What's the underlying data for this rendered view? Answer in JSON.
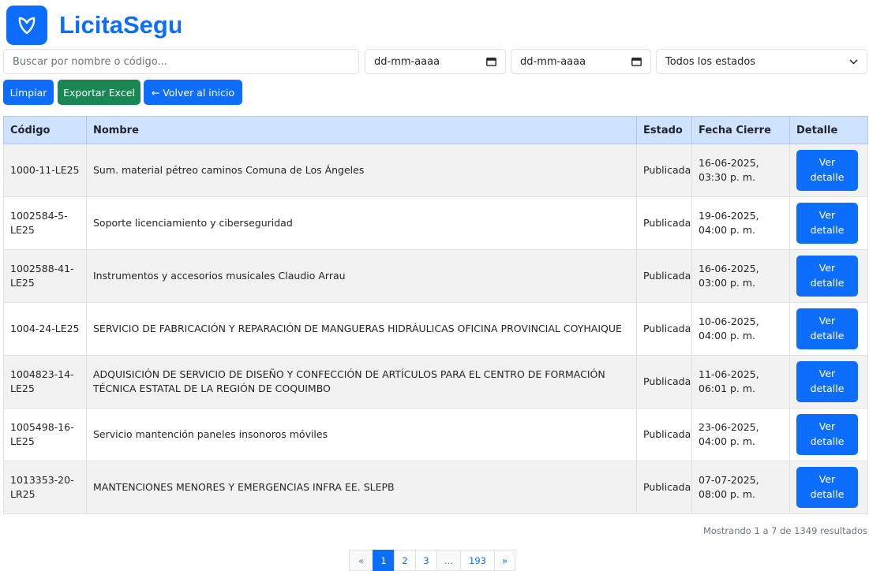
{
  "brand": {
    "name": "LicitaSegu",
    "logo_icon": "heart-outline-icon",
    "color": "#0d6efd"
  },
  "filters": {
    "search_placeholder": "Buscar por nombre o código...",
    "date_from": "dd-mm-aaaa",
    "date_to": "dd-mm-aaaa",
    "status_selected": "Todos los estados"
  },
  "actions": {
    "clear_label": "Limpiar",
    "export_label": "Exportar Excel",
    "back_label": "← Volver al inicio"
  },
  "table": {
    "headers": {
      "code": "Código",
      "name": "Nombre",
      "status": "Estado",
      "close_date": "Fecha Cierre",
      "detail": "Detalle"
    },
    "detail_button": "Ver detalle",
    "rows": [
      {
        "code": "1000-11-LE25",
        "name": "Sum. material pétreo caminos Comuna de Los Ángeles",
        "status": "Publicada",
        "close_date": "16-06-2025, 03:30 p. m."
      },
      {
        "code": "1002584-5-LE25",
        "name": "Soporte licenciamiento y ciberseguridad",
        "status": "Publicada",
        "close_date": "19-06-2025, 04:00 p. m."
      },
      {
        "code": "1002588-41-LE25",
        "name": "Instrumentos y accesorios musicales Claudio Arrau",
        "status": "Publicada",
        "close_date": "16-06-2025, 03:00 p. m."
      },
      {
        "code": "1004-24-LE25",
        "name": "SERVICIO DE FABRICACIÓN Y REPARACIÓN DE MANGUERAS HIDRÁULICAS OFICINA PROVINCIAL COYHAIQUE",
        "status": "Publicada",
        "close_date": "10-06-2025, 04:00 p. m."
      },
      {
        "code": "1004823-14-LE25",
        "name": "ADQUISICIÓN DE SERVICIO DE DISEÑO Y CONFECCIÓN DE ARTÍCULOS PARA EL CENTRO DE FORMACIÓN TÉCNICA ESTATAL DE LA REGIÓN DE COQUIMBO",
        "status": "Publicada",
        "close_date": "11-06-2025, 06:01 p. m."
      },
      {
        "code": "1005498-16-LE25",
        "name": "Servicio mantención paneles insonoros móviles",
        "status": "Publicada",
        "close_date": "23-06-2025, 04:00 p. m."
      },
      {
        "code": "1013353-20-LR25",
        "name": "MANTENCIONES MENORES Y EMERGENCIAS INFRA EE. SLEPB",
        "status": "Publicada",
        "close_date": "07-07-2025, 08:00 p. m."
      }
    ]
  },
  "summary": "Mostrando 1 a 7 de 1349 resultados",
  "pagination": {
    "prev": "«",
    "pages": [
      "1",
      "2",
      "3"
    ],
    "ellipsis": "...",
    "last": "193",
    "next": "»"
  }
}
